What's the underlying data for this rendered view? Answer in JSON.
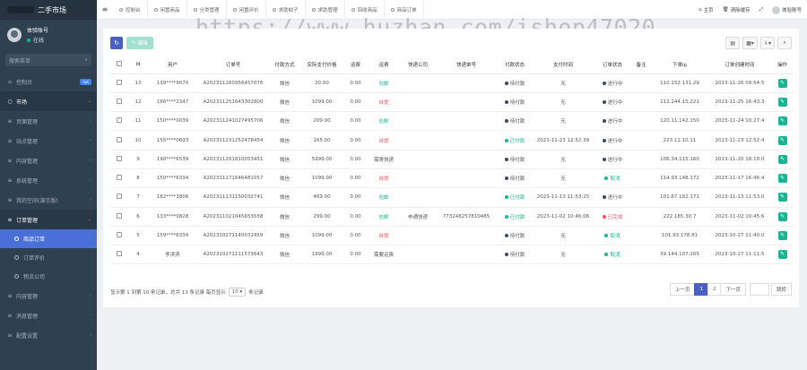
{
  "watermark": "https://www.huzhan.com/ishop47020",
  "sidebar": {
    "brand": "二手市场",
    "user_name": "体验账号",
    "user_status": "在线",
    "search_placeholder": "搜索菜单",
    "items": [
      {
        "label": "控制台",
        "icon": "home-icon",
        "badge": "hot"
      },
      {
        "label": "市场",
        "icon": "circle-icon",
        "open": true
      },
      {
        "label": "页面管理",
        "icon": "list-icon"
      },
      {
        "label": "站点管理",
        "icon": "list-icon"
      },
      {
        "label": "内容管理",
        "icon": "list-icon"
      },
      {
        "label": "系统管理",
        "icon": "list-icon"
      },
      {
        "label": "我的空间(演示版)",
        "icon": "list-icon"
      },
      {
        "label": "订单管理",
        "icon": "list-icon",
        "open": true
      }
    ],
    "sub_items": [
      {
        "label": "商品订单",
        "active": true
      },
      {
        "label": "订单评价"
      },
      {
        "label": "物流公司"
      }
    ],
    "bottom_items": [
      {
        "label": "内容管理",
        "icon": "list-icon"
      },
      {
        "label": "消息管理",
        "icon": "list-icon"
      },
      {
        "label": "配置设置",
        "icon": "list-icon"
      }
    ]
  },
  "topbar": {
    "tabs": [
      "控制台",
      "闲置商品",
      "分类管理",
      "闲置评价",
      "求助帖子",
      "求助管理",
      "回收商品",
      "商品订单"
    ],
    "right": [
      "主页",
      "清除缓存",
      "",
      "体验账号"
    ]
  },
  "toolbar": {
    "edit_label": "编辑"
  },
  "table": {
    "headers": [
      "",
      "Id",
      "用户",
      "订单号",
      "付款方式",
      "实际支付价格",
      "运费",
      "运费",
      "快递公司",
      "快递单号",
      "付款状态",
      "支付时间",
      "订单状态",
      "备注",
      "下单ip",
      "订单创建时间",
      "操作"
    ],
    "rows": [
      {
        "id": "13",
        "user": "139****9070",
        "order_no": "A202311260956457076",
        "pay": "微信",
        "price": "20.00",
        "fee": "0.00",
        "ship": "包邮",
        "ship_color": "green",
        "company": "",
        "tracking": "",
        "pay_status": "待付款",
        "pay_dot": "dark",
        "pay_time": "无",
        "order_status": "进行中",
        "order_dot": "dark",
        "remark": "",
        "ip": "110.152.131.29",
        "created": "2023-11-26 09:54:5"
      },
      {
        "id": "12",
        "user": "186****2347",
        "order_no": "A202311251643302800",
        "pay": "微信",
        "price": "1099.00",
        "fee": "0.00",
        "ship": "自提",
        "ship_color": "red",
        "company": "",
        "tracking": "",
        "pay_status": "待付款",
        "pay_dot": "dark",
        "pay_time": "无",
        "order_status": "进行中",
        "order_dot": "dark",
        "remark": "",
        "ip": "112.244.15.221",
        "created": "2023-11-25 16:43:3"
      },
      {
        "id": "11",
        "user": "150****0039",
        "order_no": "A202311241027495706",
        "pay": "微信",
        "price": "209.00",
        "fee": "0.00",
        "ship": "包邮",
        "ship_color": "green",
        "company": "",
        "tracking": "",
        "pay_status": "待付款",
        "pay_dot": "dark",
        "pay_time": "无",
        "order_status": "进行中",
        "order_dot": "dark",
        "remark": "",
        "ip": "120.11.142.150",
        "created": "2023-11-24 10:27:4"
      },
      {
        "id": "10",
        "user": "155****0693",
        "order_no": "A202311231252478454",
        "pay": "微信",
        "price": "165.00",
        "fee": "0.00",
        "ship": "自提",
        "ship_color": "red",
        "company": "",
        "tracking": "",
        "pay_status": "已付款",
        "pay_dot": "green",
        "pay_time": "2023-11-23 12:52:39",
        "order_status": "进行中",
        "order_dot": "dark",
        "remark": "",
        "ip": "223.11.10.11",
        "created": "2023-11-23 12:52:4"
      },
      {
        "id": "9",
        "user": "190****6539",
        "order_no": "A202311201810053451",
        "pay": "微信",
        "price": "5999.00",
        "fee": "0.00",
        "ship": "需寄快递",
        "ship_color": "gray",
        "company": "",
        "tracking": "",
        "pay_status": "待付款",
        "pay_dot": "dark",
        "pay_time": "无",
        "order_status": "进行中",
        "order_dot": "dark",
        "remark": "",
        "ip": "106.34.115.160",
        "created": "2023-11-20 18:10:0"
      },
      {
        "id": "8",
        "user": "150****6334",
        "order_no": "A202311171646481057",
        "pay": "微信",
        "price": "1099.00",
        "fee": "0.00",
        "ship": "自提",
        "ship_color": "red",
        "company": "",
        "tracking": "",
        "pay_status": "待付款",
        "pay_dot": "dark",
        "pay_time": "无",
        "order_status": "取消",
        "order_dot": "green",
        "remark": "",
        "ip": "114.93.148.172",
        "created": "2023-11-17 16:46:4"
      },
      {
        "id": "7",
        "user": "182****3806",
        "order_no": "A202311131150032741",
        "pay": "微信",
        "price": "469.00",
        "fee": "0.00",
        "ship": "包邮",
        "ship_color": "green",
        "company": "",
        "tracking": "",
        "pay_status": "已付款",
        "pay_dot": "green",
        "pay_time": "2023-11-13 11:53:25",
        "order_status": "进行中",
        "order_dot": "dark",
        "remark": "",
        "ip": "101.67.182.171",
        "created": "2023-11-13 11:53:0"
      },
      {
        "id": "6",
        "user": "133****0828",
        "order_no": "A202311021045653558",
        "pay": "微信",
        "price": "299.00",
        "fee": "0.00",
        "ship": "包邮",
        "ship_color": "green",
        "company": "申通快递",
        "tracking": "773248257810485",
        "pay_status": "已付款",
        "pay_dot": "green",
        "pay_time": "2023-11-02 10:46:06",
        "order_status": "已完成",
        "order_dot": "red",
        "remark": "",
        "ip": "222.185.30.7",
        "created": "2023-11-02 10:45:6"
      },
      {
        "id": "5",
        "user": "159****6334",
        "order_no": "A202310271140032459",
        "pay": "微信",
        "price": "1099.00",
        "fee": "0.00",
        "ship": "自提",
        "ship_color": "red",
        "company": "",
        "tracking": "",
        "pay_status": "待付款",
        "pay_dot": "dark",
        "pay_time": "无",
        "order_status": "取消",
        "order_dot": "green",
        "remark": "",
        "ip": "101.93.178.81",
        "created": "2023-10-27 11:40:0"
      },
      {
        "id": "4",
        "user": "李滨滨",
        "order_no": "A202310271111573643",
        "pay": "微信",
        "price": "1999.00",
        "fee": "0.00",
        "ship": "需要运费",
        "ship_color": "gray",
        "company": "",
        "tracking": "",
        "pay_status": "待付款",
        "pay_dot": "dark",
        "pay_time": "无",
        "order_status": "取消",
        "order_dot": "green",
        "remark": "",
        "ip": "39.144.107.205",
        "created": "2023-10-27 11:11:5"
      }
    ]
  },
  "footer": {
    "info_before": "显示第 1 到第 10 条记录，总共 13 条记录 每页显示",
    "page_size": "10",
    "info_after": "条记录"
  },
  "pager": {
    "prev": "上一页",
    "pages": [
      "1",
      "2"
    ],
    "next": "下一页",
    "jump": "跳转"
  },
  "colors": {
    "sidebar": "#2f4050",
    "accent": "#4a5fc1",
    "green": "#1ab394",
    "red": "#ed5565"
  }
}
